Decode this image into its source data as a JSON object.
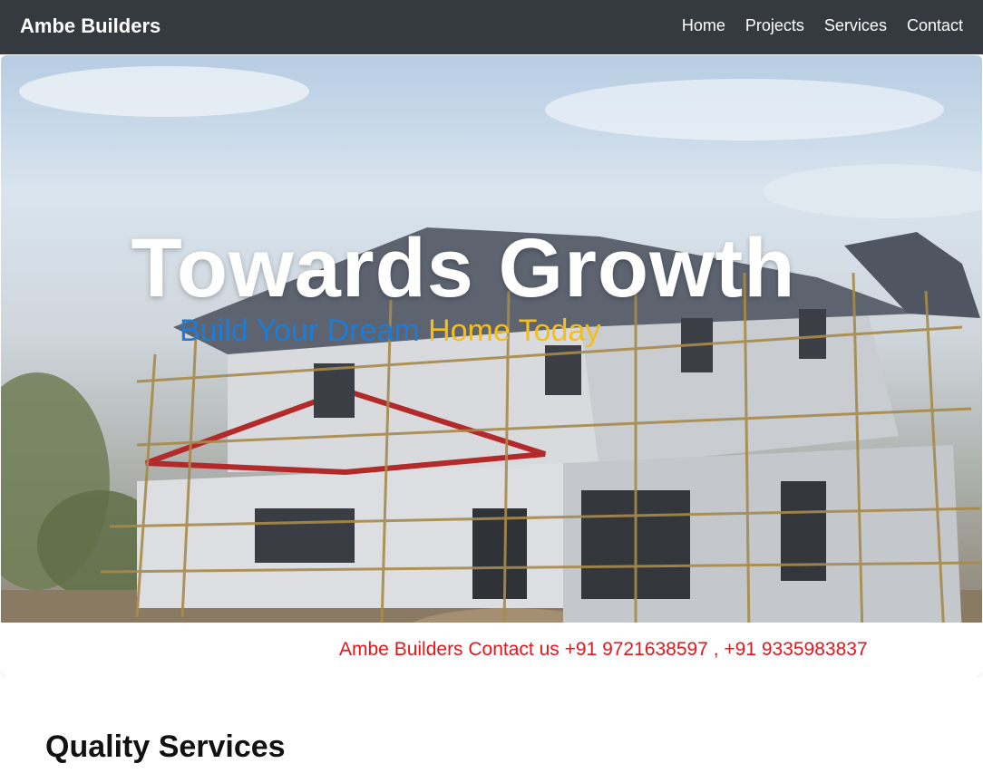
{
  "navbar": {
    "brand": "Ambe Builders",
    "links": [
      {
        "label": "Home"
      },
      {
        "label": "Projects"
      },
      {
        "label": "Services"
      },
      {
        "label": "Contact"
      }
    ]
  },
  "hero": {
    "title": "Towards Growth",
    "subtitle_blue": "Build Your Dream",
    "subtitle_gold": "Home Today",
    "image_subject": "house-under-construction-image"
  },
  "ticker": {
    "text": "Ambe Builders Contact us +91 9721638597 , +91 9335983837"
  },
  "services": {
    "title": "Quality Services"
  },
  "colors": {
    "navbar_bg": "#343a40",
    "subtitle_blue": "#1e7bd6",
    "subtitle_gold": "#f4bf1e",
    "ticker_red": "#e8151b"
  }
}
